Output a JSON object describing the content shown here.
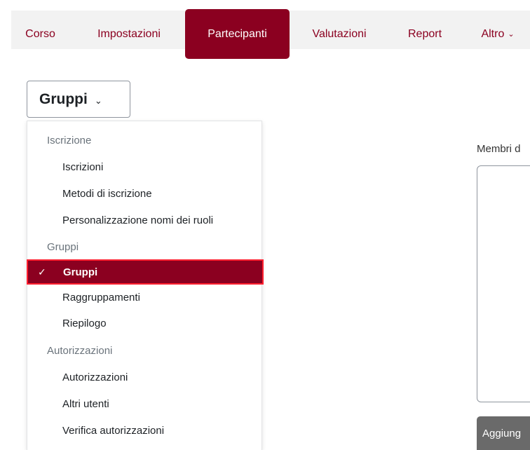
{
  "nav": {
    "items": [
      {
        "label": "Corso"
      },
      {
        "label": "Impostazioni"
      },
      {
        "label": "Partecipanti"
      },
      {
        "label": "Valutazioni"
      },
      {
        "label": "Report"
      },
      {
        "label": "Altro",
        "icon": "chevron-down-icon"
      }
    ],
    "active": "Partecipanti",
    "accent_color": "#8b0020"
  },
  "selector": {
    "current": "Gruppi",
    "icon": "chevron-down-icon"
  },
  "menu": {
    "headings": [
      "Iscrizione",
      "Gruppi",
      "Autorizzazioni"
    ],
    "items": [
      "Iscrizioni",
      "Metodi di iscrizione",
      "Personalizzazione nomi dei ruoli",
      "Gruppi",
      "Raggruppamenti",
      "Riepilogo",
      "Autorizzazioni",
      "Altri utenti",
      "Verifica autorizzazioni"
    ],
    "selected_item": "Gruppi",
    "check_icon": "check-icon"
  },
  "right_panel": {
    "members_label": "Membri d",
    "add_button_label": "Aggiung"
  }
}
